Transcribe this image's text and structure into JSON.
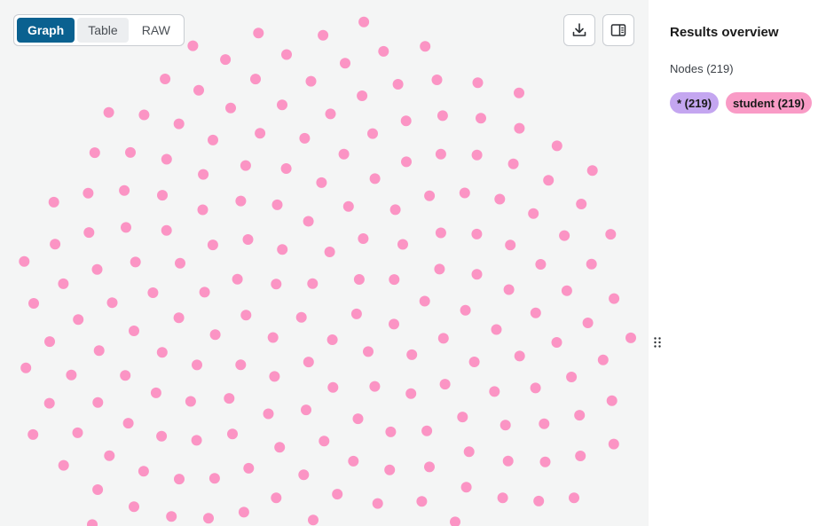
{
  "view_toggle": {
    "graph_label": "Graph",
    "table_label": "Table",
    "raw_label": "RAW",
    "active": "Graph"
  },
  "toolbar": {
    "download_icon": "download-icon",
    "panel_icon": "toggle-panel-icon"
  },
  "results": {
    "title": "Results overview",
    "nodes_label": "Nodes (219)",
    "chips": [
      {
        "label": "* (219)",
        "color": "#c4a6f0"
      },
      {
        "label": "student (219)",
        "color": "#f99bc6"
      }
    ]
  },
  "graph": {
    "node_color": "#fb94c4",
    "node_count": 219
  }
}
